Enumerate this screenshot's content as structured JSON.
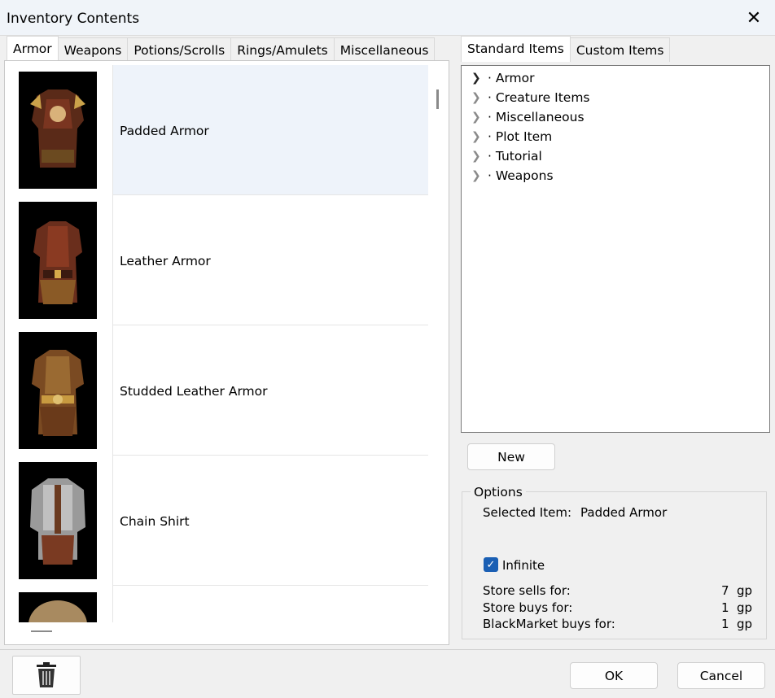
{
  "window": {
    "title": "Inventory Contents",
    "close_glyph": "✕"
  },
  "left_tabs": [
    "Armor",
    "Weapons",
    "Potions/Scrolls",
    "Rings/Amulets",
    "Miscellaneous"
  ],
  "right_tabs": [
    "Standard Items",
    "Custom Items"
  ],
  "items": [
    {
      "label": "Padded Armor",
      "selected": true
    },
    {
      "label": "Leather Armor",
      "selected": false
    },
    {
      "label": "Studded Leather Armor",
      "selected": false
    },
    {
      "label": "Chain Shirt",
      "selected": false
    },
    {
      "label": "",
      "selected": false
    }
  ],
  "tree": [
    {
      "label": "· Armor",
      "icon": "chevron-right-icon"
    },
    {
      "label": "· Creature Items",
      "icon": "chevron-right-icon"
    },
    {
      "label": "· Miscellaneous",
      "icon": "chevron-right-icon"
    },
    {
      "label": "· Plot Item",
      "icon": "chevron-right-icon"
    },
    {
      "label": "· Tutorial",
      "icon": "chevron-right-icon"
    },
    {
      "label": "· Weapons",
      "icon": "chevron-right-icon"
    }
  ],
  "buttons": {
    "new": "New",
    "ok": "OK",
    "cancel": "Cancel",
    "delete_icon": "trash-icon"
  },
  "options": {
    "title": "Options",
    "selected_item_label": "Selected Item:",
    "selected_item_value": "Padded Armor",
    "infinite_label": "Infinite",
    "infinite_checked": true,
    "store_sells_label": "Store sells for:",
    "store_sells_value": "7",
    "store_buys_label": "Store buys for:",
    "store_buys_value": "1",
    "blackmarket_label": "BlackMarket buys for:",
    "blackmarket_value": "1",
    "unit": "gp"
  },
  "colors": {
    "accent": "#1a5fb4",
    "selected_row": "#eef3fa"
  }
}
